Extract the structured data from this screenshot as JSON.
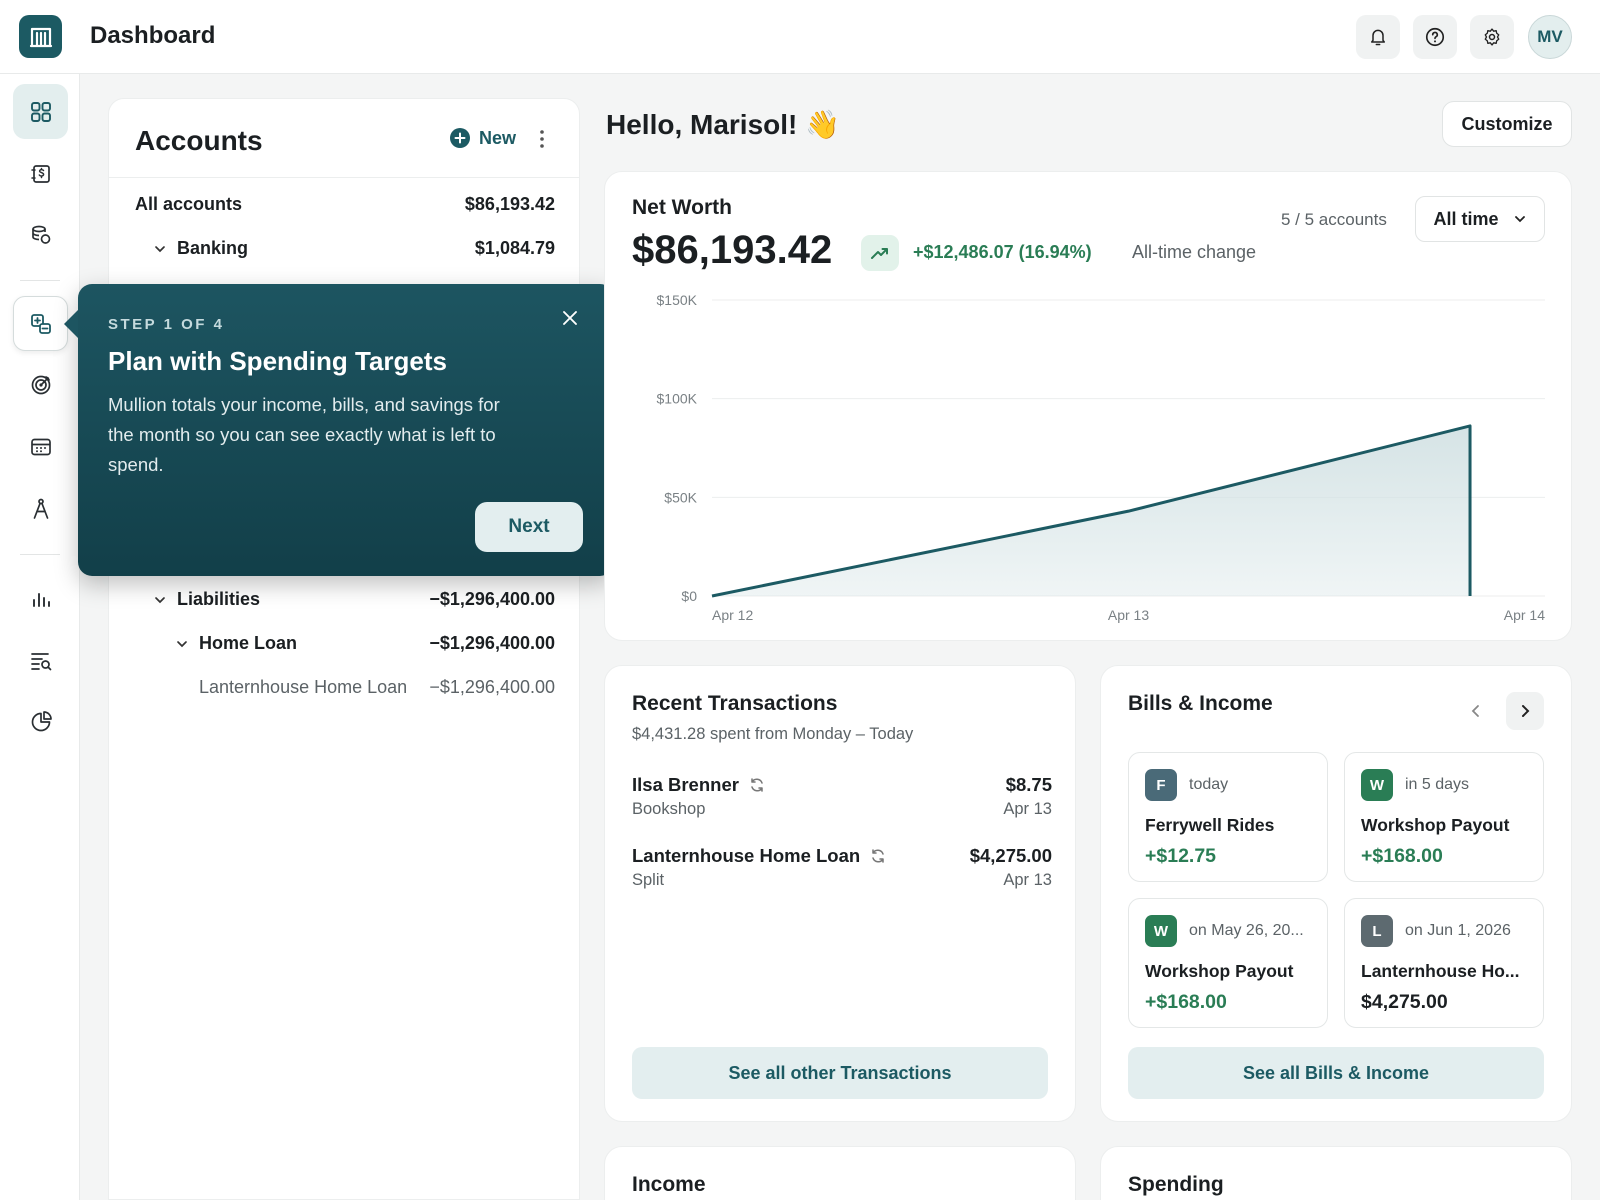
{
  "header": {
    "title": "Dashboard",
    "avatar_initials": "MV",
    "icons": [
      "bell-icon",
      "help-icon",
      "settings-icon"
    ]
  },
  "sidebar": {
    "items": [
      {
        "name": "dashboard",
        "icon": "grid-icon",
        "active": true
      },
      {
        "name": "transactions",
        "icon": "money-icon"
      },
      {
        "name": "accounts",
        "icon": "coins-icon"
      },
      {
        "name": "spending-targets",
        "icon": "plan-icon",
        "highlight": true
      },
      {
        "name": "goals",
        "icon": "target-icon"
      },
      {
        "name": "recurring",
        "icon": "calendar-icon"
      },
      {
        "name": "advisor",
        "icon": "compass-icon"
      },
      {
        "name": "reports",
        "icon": "bar-chart-icon"
      },
      {
        "name": "search",
        "icon": "list-search-icon"
      },
      {
        "name": "insights",
        "icon": "pie-icon"
      }
    ]
  },
  "accounts": {
    "title": "Accounts",
    "new_label": "New",
    "rows": [
      {
        "label": "All accounts",
        "amount": "$86,193.42",
        "level": 0
      },
      {
        "label": "Banking",
        "amount": "$1,084.79",
        "level": 1
      },
      {
        "label": "Liabilities",
        "amount": "−$1,296,400.00",
        "level": 1
      },
      {
        "label": "Home Loan",
        "amount": "−$1,296,400.00",
        "level": 2
      },
      {
        "label": "Lanternhouse Home Loan",
        "amount": "−$1,296,400.00",
        "level": 3
      }
    ]
  },
  "tour": {
    "step": "STEP 1 OF 4",
    "title": "Plan with Spending Targets",
    "body": "Mullion totals your income, bills, and savings for the month so you can see exactly what is left to spend.",
    "next_label": "Next"
  },
  "greeting": "Hello, Marisol! 👋",
  "customize_label": "Customize",
  "net_worth": {
    "title": "Net Worth",
    "value": "$86,193.42",
    "change": "+$12,486.07 (16.94%)",
    "change_label": "All-time change",
    "accounts_count": "5 / 5 accounts",
    "range": "All time"
  },
  "chart_data": {
    "type": "area",
    "x": [
      "Apr 12",
      "Apr 13",
      "Apr 14"
    ],
    "y_ticks": [
      "$0",
      "$50K",
      "$100K",
      "$150K"
    ],
    "ylim": [
      0,
      150000
    ],
    "series": [
      {
        "values": [
          0,
          43000,
          86193.42
        ]
      }
    ],
    "grid": true,
    "colors": {
      "line": "#1c5a63",
      "fill": "#d3e2e4"
    }
  },
  "transactions": {
    "title": "Recent Transactions",
    "subtitle": "$4,431.28 spent from Monday – Today",
    "items": [
      {
        "name": "Ilsa Brenner",
        "category": "Bookshop",
        "amount": "$8.75",
        "date": "Apr 13"
      },
      {
        "name": "Lanternhouse Home Loan",
        "category": "Split",
        "amount": "$4,275.00",
        "date": "Apr 13"
      }
    ],
    "see_all_label": "See all other Transactions"
  },
  "bills": {
    "title": "Bills & Income",
    "items": [
      {
        "badge": "F",
        "badge_color": "#4a6a78",
        "when": "today",
        "name": "Ferrywell Rides",
        "amount": "+$12.75",
        "positive": true
      },
      {
        "badge": "W",
        "badge_color": "#2a7d55",
        "when": "in 5 days",
        "name": "Workshop Payout",
        "amount": "+$168.00",
        "positive": true
      },
      {
        "badge": "W",
        "badge_color": "#2a7d55",
        "when": "on May 26, 20...",
        "name": "Workshop Payout",
        "amount": "+$168.00",
        "positive": true
      },
      {
        "badge": "L",
        "badge_color": "#5d6a70",
        "when": "on Jun 1, 2026",
        "name": "Lanternhouse Ho...",
        "amount": "$4,275.00",
        "positive": false
      }
    ],
    "see_all_label": "See all Bills & Income"
  },
  "income": {
    "title": "Income"
  },
  "spending": {
    "title": "Spending"
  }
}
